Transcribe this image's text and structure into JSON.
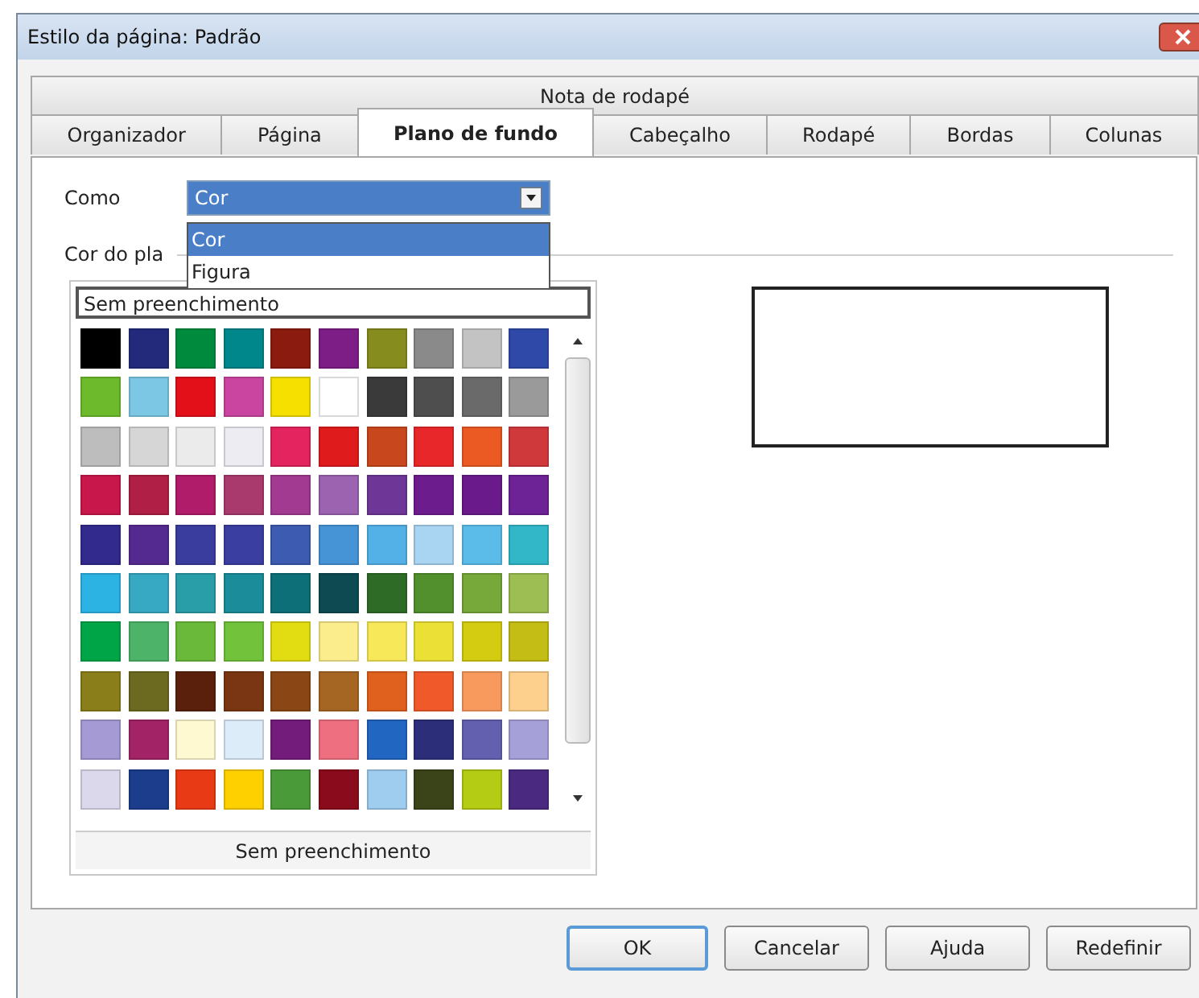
{
  "window": {
    "title": "Estilo da página: Padrão"
  },
  "tabs_top": [
    {
      "label": "Nota de rodapé",
      "selected": false
    }
  ],
  "tabs": [
    {
      "label": "Organizador",
      "selected": false
    },
    {
      "label": "Página",
      "selected": false
    },
    {
      "label": "Plano de fundo",
      "selected": true
    },
    {
      "label": "Cabeçalho",
      "selected": false
    },
    {
      "label": "Rodapé",
      "selected": false
    },
    {
      "label": "Bordas",
      "selected": false
    },
    {
      "label": "Colunas",
      "selected": false
    }
  ],
  "como": {
    "label": "Como",
    "value": "Cor",
    "options": [
      {
        "label": "Cor",
        "selected": true
      },
      {
        "label": "Figura",
        "selected": false
      }
    ]
  },
  "background_color_label": "Cor do pla",
  "palette": {
    "name_field": "Sem preenchimento",
    "footer_button": "Sem preenchimento",
    "rows": [
      [
        {
          "color": "#000000"
        },
        {
          "color": "#232a7c"
        },
        {
          "color": "#008a3e"
        },
        {
          "color": "#00878c"
        },
        {
          "color": "#8b1a0f"
        },
        {
          "color": "#7d1d86"
        },
        {
          "color": "#878c1e"
        },
        {
          "color": "#8a8a8a"
        },
        {
          "color": "#c3c3c3"
        },
        {
          "color": "#2f49a8"
        }
      ],
      [
        {
          "color": "#6dbb2c"
        },
        {
          "color": "#7cc8e4"
        },
        {
          "color": "#e3101a"
        },
        {
          "color": "#c945a0"
        },
        {
          "color": "#f5e000"
        },
        {
          "color": "#ffffff"
        },
        {
          "color": "#3a3a3a"
        },
        {
          "color": "#4e4e4e"
        },
        {
          "color": "#6a6a6a"
        },
        {
          "color": "#9a9a9a"
        }
      ],
      [
        {
          "color": "#bdbdbd"
        },
        {
          "color": "#d6d6d6"
        },
        {
          "color": "#ebebeb"
        },
        {
          "color": "#ececf2"
        },
        {
          "color": "#e3245e"
        },
        {
          "color": "#e01b1b"
        },
        {
          "color": "#c8471c"
        },
        {
          "color": "#e8272a"
        },
        {
          "color": "#ec5a24"
        },
        {
          "color": "#d0393c"
        }
      ],
      [
        {
          "color": "#c8174a"
        },
        {
          "color": "#b01f45"
        },
        {
          "color": "#b01c6a"
        },
        {
          "color": "#a93a6e"
        },
        {
          "color": "#a23a92"
        },
        {
          "color": "#9b63b0"
        },
        {
          "color": "#6e3696"
        },
        {
          "color": "#6d1c8e"
        },
        {
          "color": "#6a1a8a"
        },
        {
          "color": "#6d2296"
        }
      ],
      [
        {
          "color": "#322a8c"
        },
        {
          "color": "#542a90"
        },
        {
          "color": "#3a3d9e"
        },
        {
          "color": "#3a3ea0"
        },
        {
          "color": "#3d5bb0"
        },
        {
          "color": "#4693d6"
        },
        {
          "color": "#54b1e8"
        },
        {
          "color": "#a9d5f2"
        },
        {
          "color": "#5bbce9"
        },
        {
          "color": "#32b7c8"
        }
      ],
      [
        {
          "color": "#2db3e3"
        },
        {
          "color": "#38a9c2"
        },
        {
          "color": "#2a9ea8"
        },
        {
          "color": "#1a8c9a"
        },
        {
          "color": "#0d6f78"
        },
        {
          "color": "#0d4a52"
        },
        {
          "color": "#2e6b26"
        },
        {
          "color": "#52902e"
        },
        {
          "color": "#76a83a"
        },
        {
          "color": "#9cbe52"
        }
      ],
      [
        {
          "color": "#00a548"
        },
        {
          "color": "#4db368"
        },
        {
          "color": "#6ab93a"
        },
        {
          "color": "#73c23b"
        },
        {
          "color": "#e2dc12"
        },
        {
          "color": "#fbec8c"
        },
        {
          "color": "#f7e85a"
        },
        {
          "color": "#ebe036"
        },
        {
          "color": "#d4cc10"
        },
        {
          "color": "#c4bd16"
        }
      ],
      [
        {
          "color": "#8a7e1a"
        },
        {
          "color": "#6c6a20"
        },
        {
          "color": "#5a200c"
        },
        {
          "color": "#7a3612"
        },
        {
          "color": "#8a4614"
        },
        {
          "color": "#a56624"
        },
        {
          "color": "#e0601e"
        },
        {
          "color": "#f05a2a"
        },
        {
          "color": "#f89a5e"
        },
        {
          "color": "#fdd08e"
        }
      ],
      [
        {
          "color": "#a59ad4"
        },
        {
          "color": "#a22466"
        },
        {
          "color": "#fff9d2"
        },
        {
          "color": "#dcecf8"
        },
        {
          "color": "#741c7c"
        },
        {
          "color": "#ee7080"
        },
        {
          "color": "#2166c0"
        },
        {
          "color": "#2c2e7a"
        },
        {
          "color": "#6460b0"
        },
        {
          "color": "#a6a0d8"
        }
      ],
      [
        {
          "color": "#dcd8ec"
        },
        {
          "color": "#1c3c8c"
        },
        {
          "color": "#e83a14"
        },
        {
          "color": "#fed000"
        },
        {
          "color": "#4a9a3a"
        },
        {
          "color": "#8a0c1c"
        },
        {
          "color": "#9ecdf0"
        },
        {
          "color": "#3a4418"
        },
        {
          "color": "#b4cc14"
        },
        {
          "color": "#4a2a80"
        }
      ]
    ]
  },
  "buttons": [
    {
      "label": "OK",
      "default": true
    },
    {
      "label": "Cancelar",
      "default": false
    },
    {
      "label": "Ajuda",
      "default": false
    },
    {
      "label": "Redefinir",
      "default": false
    }
  ]
}
